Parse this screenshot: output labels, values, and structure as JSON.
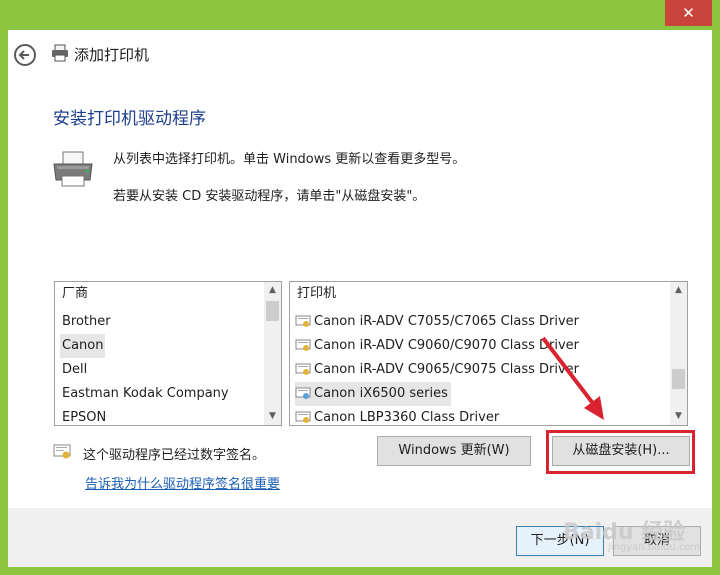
{
  "window": {
    "title": "添加打印机",
    "close_glyph": "✕"
  },
  "page": {
    "heading": "安装打印机驱动程序",
    "desc1": "从列表中选择打印机。单击 Windows 更新以查看更多型号。",
    "desc2": "若要从安装 CD 安装驱动程序，请单击\"从磁盘安装\"。"
  },
  "manufacturers": {
    "header": "厂商",
    "items": [
      "Brother",
      "Canon",
      "Dell",
      "Eastman Kodak Company",
      "EPSON"
    ],
    "selected": "Canon"
  },
  "printers": {
    "header": "打印机",
    "items": [
      "Canon iR-ADV C7055/C7065 Class Driver",
      "Canon iR-ADV C9060/C9070 Class Driver",
      "Canon iR-ADV C9065/C9075 Class Driver",
      "Canon iX6500 series",
      "Canon LBP3360 Class Driver"
    ],
    "selected": "Canon iX6500 series"
  },
  "signature": {
    "text": "这个驱动程序已经过数字签名。",
    "link": "告诉我为什么驱动程序签名很重要"
  },
  "buttons": {
    "windows_update": "Windows 更新(W)",
    "have_disk": "从磁盘安装(H)...",
    "next": "下一步(N)",
    "cancel": "取消"
  },
  "watermark": {
    "main": "Baidu 经验",
    "sub": "jingyan.baidu.com"
  },
  "colors": {
    "accent_heading": "#1f3f8f",
    "highlight_box": "#d9232e",
    "link": "#1a5fb4",
    "close_button": "#c9443b",
    "desktop": "#8cc641"
  }
}
